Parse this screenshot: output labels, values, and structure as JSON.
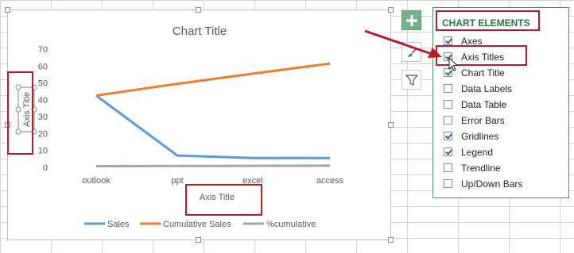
{
  "chart": {
    "title": "Chart Title",
    "x_axis_title": "Axis Title",
    "y_axis_title": "Axis Title"
  },
  "chart_data": {
    "type": "line",
    "title": "Chart Title",
    "xlabel": "Axis Title",
    "ylabel": "Axis Title",
    "categories": [
      "outlook",
      "ppt",
      "excel",
      "access"
    ],
    "ylim": [
      0,
      70
    ],
    "yticks": [
      0,
      10,
      20,
      30,
      40,
      50,
      60,
      70
    ],
    "series": [
      {
        "name": "Sales",
        "color": "#5b9bd5",
        "values": [
          42.5,
          7,
          5.5,
          5.5
        ]
      },
      {
        "name": "Cumulative Sales",
        "color": "#ed7d31",
        "values": [
          42.5,
          49.5,
          55.5,
          61.5
        ]
      },
      {
        "name": "%cumulative",
        "color": "#a5a5a5",
        "values": [
          0.7,
          0.8,
          0.9,
          1
        ]
      }
    ],
    "grid": false,
    "legend": "bottom"
  },
  "panel": {
    "title": "CHART ELEMENTS",
    "items": [
      {
        "label": "Axes",
        "checked": true
      },
      {
        "label": "Axis Titles",
        "checked": true
      },
      {
        "label": "Chart Title",
        "checked": true
      },
      {
        "label": "Data Labels",
        "checked": false
      },
      {
        "label": "Data Table",
        "checked": false
      },
      {
        "label": "Error Bars",
        "checked": false
      },
      {
        "label": "Gridlines",
        "checked": true
      },
      {
        "label": "Legend",
        "checked": true
      },
      {
        "label": "Trendline",
        "checked": false
      },
      {
        "label": "Up/Down Bars",
        "checked": false
      }
    ]
  },
  "buttons": {
    "add_icon": "plus-icon",
    "style_icon": "brush-icon",
    "filter_icon": "filter-icon"
  },
  "colors": {
    "annotation": "#b11e2b",
    "panel_accent": "#2e7245",
    "checkbox_check": "#2f63a8"
  }
}
